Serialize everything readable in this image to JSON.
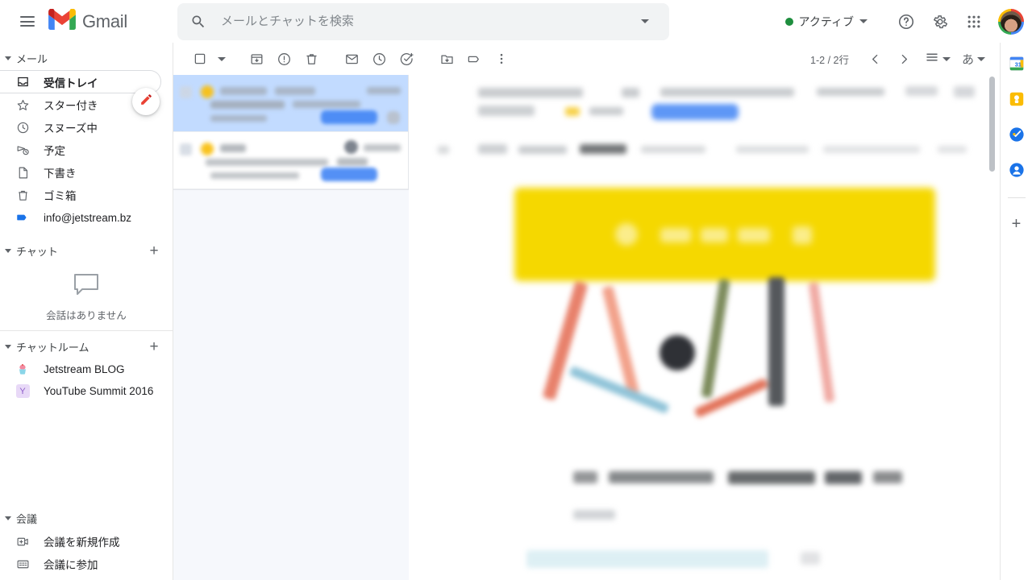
{
  "app": {
    "brand_name": "Gmail",
    "menu_icon": "hamburger-icon",
    "logo_icon": "gmail-logo-icon"
  },
  "search": {
    "placeholder": "メールとチャットを検索",
    "value": "",
    "search_icon": "search-icon",
    "options_icon": "chevron-down-icon"
  },
  "header": {
    "status_label": "アクティブ",
    "status_color": "#1e8e3e",
    "status_caret_icon": "chevron-down-icon",
    "help_icon": "help-icon",
    "settings_icon": "gear-icon",
    "apps_icon": "apps-grid-icon",
    "avatar_icon": "avatar"
  },
  "sidebar": {
    "mail_section": {
      "title": "メール",
      "caret_icon": "caret-down-icon",
      "compose_icon": "compose-pencil-icon",
      "items": [
        {
          "label": "受信トレイ",
          "icon": "inbox-icon",
          "selected": true
        },
        {
          "label": "スター付き",
          "icon": "star-icon",
          "selected": false
        },
        {
          "label": "スヌーズ中",
          "icon": "clock-icon",
          "selected": false
        },
        {
          "label": "予定",
          "icon": "send-later-icon",
          "selected": false
        },
        {
          "label": "下書き",
          "icon": "draft-icon",
          "selected": false
        },
        {
          "label": "ゴミ箱",
          "icon": "trash-icon",
          "selected": false
        },
        {
          "label": "info@jetstream.bz",
          "icon": "label-tag-icon",
          "selected": false
        }
      ]
    },
    "chat_section": {
      "title": "チャット",
      "caret_icon": "caret-down-icon",
      "add_icon": "plus-icon",
      "empty_icon": "speech-bubble-icon",
      "empty_text": "会話はありません"
    },
    "rooms_section": {
      "title": "チャットルーム",
      "caret_icon": "caret-down-icon",
      "add_icon": "plus-icon",
      "items": [
        {
          "label": "Jetstream BLOG",
          "icon": "cupcake-icon"
        },
        {
          "label": "YouTube Summit 2016",
          "icon": "letter-y-icon",
          "badge": "Y"
        }
      ]
    },
    "meet_section": {
      "title": "会議",
      "caret_icon": "caret-down-icon",
      "items": [
        {
          "label": "会議を新規作成",
          "icon": "new-meeting-icon"
        },
        {
          "label": "会議に参加",
          "icon": "join-meeting-icon"
        }
      ]
    }
  },
  "toolbar": {
    "select_all_icon": "checkbox-icon",
    "select_caret_icon": "chevron-down-icon",
    "archive_icon": "archive-icon",
    "report_spam_icon": "report-spam-icon",
    "delete_icon": "trash-icon",
    "mark_unread_icon": "envelope-icon",
    "snooze_icon": "clock-icon",
    "add_to_tasks_icon": "add-to-tasks-icon",
    "move_to_icon": "move-to-folder-icon",
    "labels_icon": "label-tag-icon",
    "more_icon": "more-vertical-icon",
    "pagination_text": "1-2 / 2行",
    "prev_icon": "chevron-left-icon",
    "next_icon": "chevron-right-icon",
    "density_icon": "density-list-icon",
    "density_caret_icon": "chevron-down-icon",
    "input_method_label": "あ",
    "input_method_caret_icon": "chevron-down-icon"
  },
  "mail_list": {
    "rows": [
      {
        "state": "selected",
        "redacted": true
      },
      {
        "state": "unread",
        "redacted": true
      }
    ]
  },
  "reading_pane": {
    "redacted": true,
    "banner_color": "#f5d800",
    "scrollbar_icon": "scrollbar-thumb"
  },
  "right_rail": {
    "items": [
      {
        "icon": "google-calendar-icon"
      },
      {
        "icon": "google-keep-icon"
      },
      {
        "icon": "google-tasks-icon"
      },
      {
        "icon": "google-contacts-icon"
      }
    ],
    "add_icon": "plus-icon"
  }
}
